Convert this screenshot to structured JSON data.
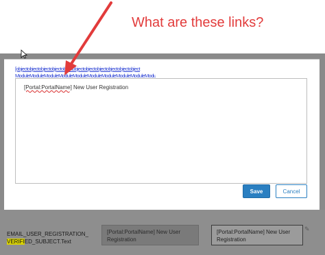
{
  "annotation": {
    "text": "What are these links?",
    "color": "#e23b3b"
  },
  "links": {
    "row1": "[objectobjectobjectobjectobjectobjectobjectobjectobjectobjectobject",
    "row2": "ModuleModuleModuleModuleModuleModuleModuleModuleModuleModuleModule]"
  },
  "editor": {
    "token": "[Portal:PortalName]",
    "text": " New User Registration"
  },
  "buttons": {
    "save": "Save",
    "cancel": "Cancel"
  },
  "grid_row": {
    "resource_key_prefix": "EMAIL_USER_REGISTRATION_",
    "resource_key_highlight": "VERIFI",
    "resource_key_suffix": "ED_SUBJECT.Text",
    "default_value": "[Portal:PortalName] New User Registration",
    "localized_value": "[Portal:PortalName] New User Registration"
  },
  "colors": {
    "accent": "#2a7fc1",
    "link": "#2b41d4",
    "highlight": "#d9d200"
  },
  "icons": [
    "cursor-icon",
    "pencil-icon",
    "annotation-arrow"
  ]
}
